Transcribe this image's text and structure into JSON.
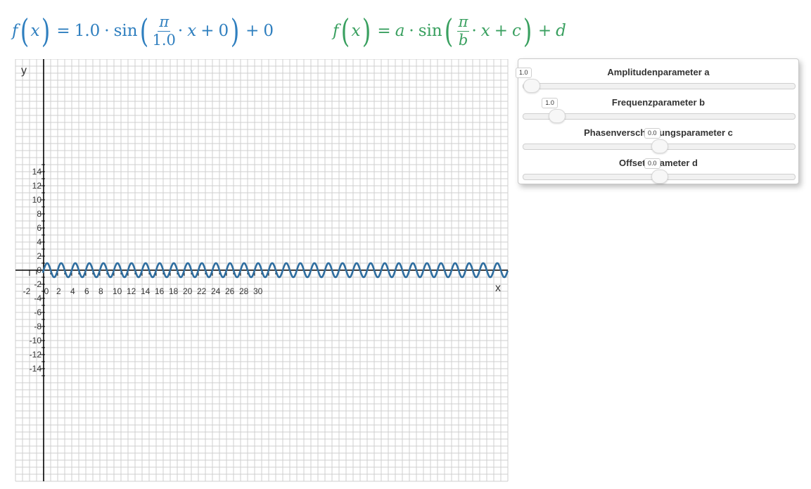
{
  "formula_current": {
    "f": "f",
    "x": "x",
    "eq": "=",
    "a": "1.0",
    "dot": "·",
    "sin": "sin",
    "num": "π",
    "den": "1.0",
    "x2": "x",
    "plus1": "+",
    "c": "0",
    "plus2": "+",
    "d": "0"
  },
  "formula_general": {
    "f": "f",
    "x": "x",
    "eq": "=",
    "a": "a",
    "dot": "·",
    "sin": "sin",
    "num": "π",
    "den": "b",
    "x2": "x",
    "plus1": "+",
    "c": "c",
    "plus2": "+",
    "d": "d"
  },
  "panel": {
    "sliders": [
      {
        "label": "Amplitudenparameter a",
        "value": "1.0",
        "min": 1,
        "max": 10,
        "current": 1.0
      },
      {
        "label": "Frequenzparameter b",
        "value": "1.0",
        "min": 0,
        "max": 10,
        "current": 1.0
      },
      {
        "label": "Phasenverschiebungsparameter c",
        "value": "0.0",
        "min": -10,
        "max": 10,
        "current": 0.0
      },
      {
        "label": "Offsetparameter d",
        "value": "0.0",
        "min": -10,
        "max": 10,
        "current": 0.0
      }
    ]
  },
  "chart_data": {
    "type": "line",
    "xlabel": "x",
    "ylabel": "y",
    "xlim": [
      -2,
      33
    ],
    "ylim": [
      -15,
      15
    ],
    "x_ticks": [
      "-2",
      "0",
      "2",
      "4",
      "6",
      "8",
      "10",
      "12",
      "14",
      "16",
      "18",
      "20",
      "22",
      "24",
      "26",
      "28",
      "30"
    ],
    "y_ticks": [
      "14",
      "12",
      "10",
      "8",
      "6",
      "4",
      "2",
      "0",
      "-2",
      "-4",
      "-6",
      "-8",
      "-10",
      "-12",
      "-14"
    ],
    "grid": true,
    "function": {
      "a": 1.0,
      "b": 1.0,
      "c": 0,
      "d": 0
    },
    "color": "#2f6ea0"
  }
}
